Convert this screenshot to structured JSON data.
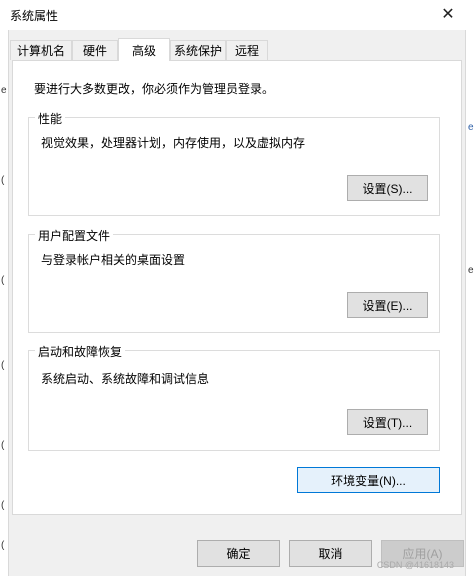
{
  "window": {
    "title": "系统属性",
    "close_glyph": "✕"
  },
  "tabs": [
    {
      "label": "计算机名"
    },
    {
      "label": "硬件"
    },
    {
      "label": "高级",
      "active": true
    },
    {
      "label": "系统保护"
    },
    {
      "label": "远程"
    }
  ],
  "admin_note": "要进行大多数更改，你必须作为管理员登录。",
  "groups": {
    "performance": {
      "title": "性能",
      "description": "视觉效果，处理器计划，内存使用，以及虚拟内存",
      "button": "设置(S)..."
    },
    "user_profiles": {
      "title": "用户配置文件",
      "description": "与登录帐户相关的桌面设置",
      "button": "设置(E)..."
    },
    "startup_recovery": {
      "title": "启动和故障恢复",
      "description": "系统启动、系统故障和调试信息",
      "button": "设置(T)..."
    }
  },
  "env_button": "环境变量(N)...",
  "footer": {
    "ok": "确定",
    "cancel": "取消",
    "apply": "应用(A)"
  },
  "watermark": "CSDN @41618143",
  "colors": {
    "focus_border": "#0078d7",
    "panel_bg": "#ffffff",
    "dialog_bg": "#f0f0f0"
  }
}
